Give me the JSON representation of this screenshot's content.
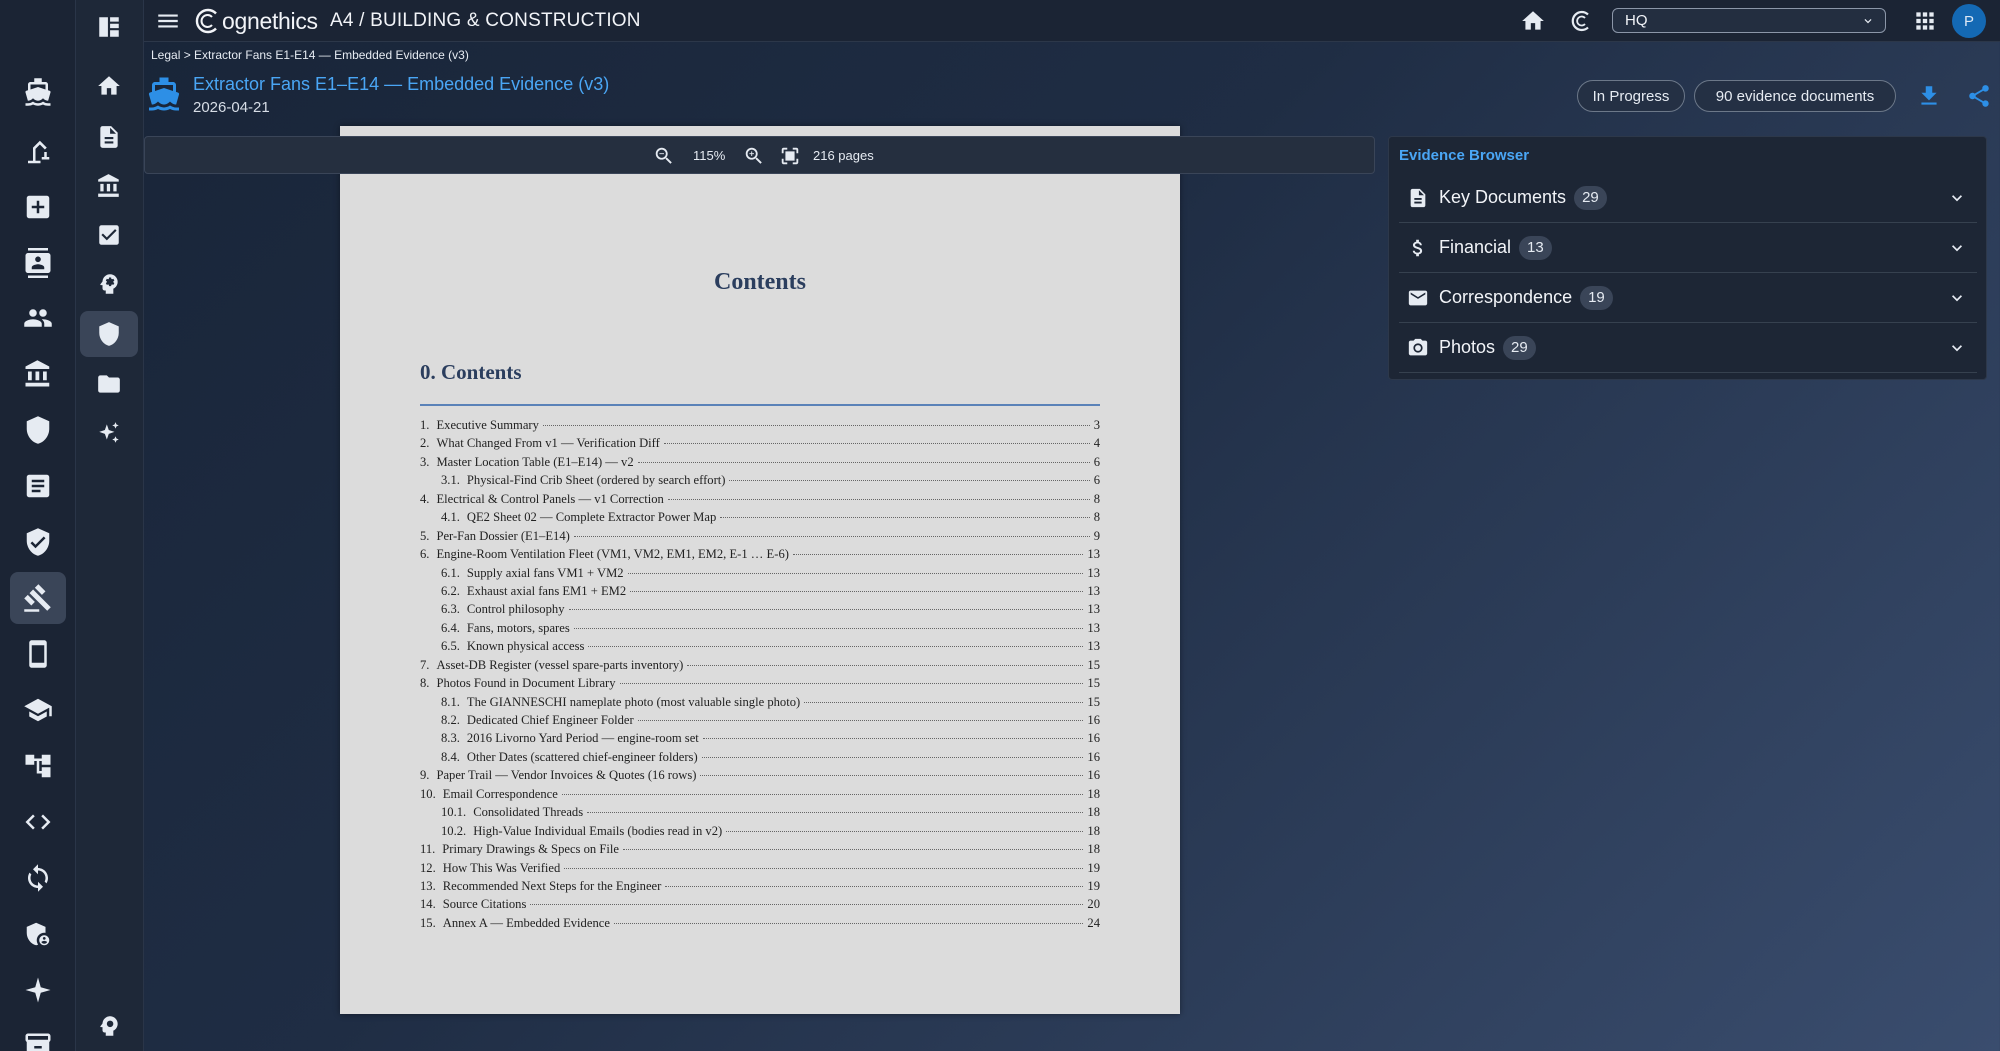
{
  "app": {
    "brand_name": "ognethics",
    "title": "A4 / BUILDING & CONSTRUCTION"
  },
  "topbar": {
    "workspace_select": "HQ",
    "avatar_initial": "P"
  },
  "breadcrumb": "Legal > Extractor Fans E1-E14 — Embedded Evidence (v3)",
  "document": {
    "title": "Extractor Fans E1–E14 — Embedded Evidence (v3)",
    "date": "2026-04-21",
    "status": "In Progress",
    "evidence_count": "90 evidence documents"
  },
  "viewer": {
    "zoom": "115%",
    "pages": "216 pages"
  },
  "page": {
    "heading": "Contents",
    "section_heading": "0. Contents",
    "toc": [
      {
        "num": "1.",
        "title": "Executive Summary",
        "page": "3",
        "sub": false
      },
      {
        "num": "2.",
        "title": "What Changed From v1 — Verification Diff",
        "page": "4",
        "sub": false
      },
      {
        "num": "3.",
        "title": "Master Location Table (E1–E14) — v2",
        "page": "6",
        "sub": false
      },
      {
        "num": "3.1.",
        "title": "Physical-Find Crib Sheet (ordered by search effort)",
        "page": "6",
        "sub": true
      },
      {
        "num": "4.",
        "title": "Electrical & Control Panels — v1 Correction",
        "page": "8",
        "sub": false
      },
      {
        "num": "4.1.",
        "title": "QE2 Sheet 02 — Complete Extractor Power Map",
        "page": "8",
        "sub": true
      },
      {
        "num": "5.",
        "title": "Per-Fan Dossier (E1–E14)",
        "page": "9",
        "sub": false
      },
      {
        "num": "6.",
        "title": "Engine-Room Ventilation Fleet (VM1, VM2, EM1, EM2, E-1 … E-6)",
        "page": "13",
        "sub": false
      },
      {
        "num": "6.1.",
        "title": "Supply axial fans VM1 + VM2",
        "page": "13",
        "sub": true
      },
      {
        "num": "6.2.",
        "title": "Exhaust axial fans EM1 + EM2",
        "page": "13",
        "sub": true
      },
      {
        "num": "6.3.",
        "title": "Control philosophy",
        "page": "13",
        "sub": true
      },
      {
        "num": "6.4.",
        "title": "Fans, motors, spares",
        "page": "13",
        "sub": true
      },
      {
        "num": "6.5.",
        "title": "Known physical access",
        "page": "13",
        "sub": true
      },
      {
        "num": "7.",
        "title": "Asset-DB Register (vessel spare-parts inventory)",
        "page": "15",
        "sub": false
      },
      {
        "num": "8.",
        "title": "Photos Found in Document Library",
        "page": "15",
        "sub": false
      },
      {
        "num": "8.1.",
        "title": "The GIANNESCHI nameplate photo (most valuable single photo)",
        "page": "15",
        "sub": true
      },
      {
        "num": "8.2.",
        "title": "Dedicated Chief Engineer Folder",
        "page": "16",
        "sub": true
      },
      {
        "num": "8.3.",
        "title": "2016 Livorno Yard Period — engine-room set",
        "page": "16",
        "sub": true
      },
      {
        "num": "8.4.",
        "title": "Other Dates (scattered chief-engineer folders)",
        "page": "16",
        "sub": true
      },
      {
        "num": "9.",
        "title": "Paper Trail — Vendor Invoices & Quotes (16 rows)",
        "page": "16",
        "sub": false
      },
      {
        "num": "10.",
        "title": "Email Correspondence",
        "page": "18",
        "sub": false
      },
      {
        "num": "10.1.",
        "title": "Consolidated Threads",
        "page": "18",
        "sub": true
      },
      {
        "num": "10.2.",
        "title": "High-Value Individual Emails (bodies read in v2)",
        "page": "18",
        "sub": true
      },
      {
        "num": "11.",
        "title": "Primary Drawings & Specs on File",
        "page": "18",
        "sub": false
      },
      {
        "num": "12.",
        "title": "How This Was Verified",
        "page": "19",
        "sub": false
      },
      {
        "num": "13.",
        "title": "Recommended Next Steps for the Engineer",
        "page": "19",
        "sub": false
      },
      {
        "num": "14.",
        "title": "Source Citations",
        "page": "20",
        "sub": false
      },
      {
        "num": "15.",
        "title": "Annex A — Embedded Evidence",
        "page": "24",
        "sub": false
      }
    ]
  },
  "evidence_browser": {
    "title": "Evidence Browser",
    "categories": [
      {
        "label": "Key Documents",
        "count": "29",
        "icon": "document-icon"
      },
      {
        "label": "Financial",
        "count": "13",
        "icon": "dollar-icon"
      },
      {
        "label": "Correspondence",
        "count": "19",
        "icon": "mail-icon"
      },
      {
        "label": "Photos",
        "count": "29",
        "icon": "camera-icon"
      }
    ]
  },
  "colors": {
    "accent": "#2d8fe6",
    "link": "#4aa6f5",
    "heading_navy": "#2b3e5e"
  }
}
